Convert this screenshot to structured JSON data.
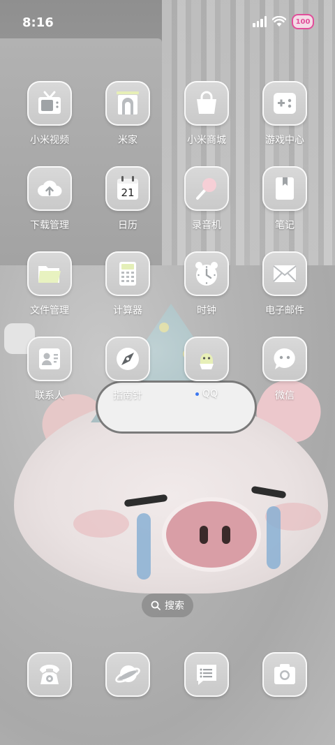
{
  "status_bar": {
    "time": "8:16",
    "battery_level": "100",
    "icons": [
      "signal-icon",
      "wifi-icon",
      "battery-icon"
    ],
    "battery_accent": "#e14e9a"
  },
  "apps": [
    {
      "label": "小米视频",
      "icon": "tv-icon"
    },
    {
      "label": "米家",
      "icon": "home-gate-icon"
    },
    {
      "label": "小米商城",
      "icon": "shopping-bag-icon"
    },
    {
      "label": "游戏中心",
      "icon": "gamepad-icon"
    },
    {
      "label": "下载管理",
      "icon": "cloud-download-icon"
    },
    {
      "label": "日历",
      "icon": "calendar-icon",
      "day": "21"
    },
    {
      "label": "录音机",
      "icon": "microphone-icon"
    },
    {
      "label": "笔记",
      "icon": "notebook-icon"
    },
    {
      "label": "文件管理",
      "icon": "folder-icon"
    },
    {
      "label": "计算器",
      "icon": "calculator-icon"
    },
    {
      "label": "时钟",
      "icon": "alarm-clock-icon"
    },
    {
      "label": "电子邮件",
      "icon": "envelope-icon"
    },
    {
      "label": "联系人",
      "icon": "contact-card-icon"
    },
    {
      "label": "指南针",
      "icon": "compass-icon"
    },
    {
      "label": "QQ",
      "icon": "penguin-icon",
      "new_indicator": true
    },
    {
      "label": "微信",
      "icon": "chat-bubble-icon"
    }
  ],
  "search": {
    "label": "搜索",
    "icon": "search-icon"
  },
  "dock": [
    {
      "name": "phone",
      "icon": "phone-icon"
    },
    {
      "name": "browser",
      "icon": "planet-icon"
    },
    {
      "name": "messages",
      "icon": "message-icon"
    },
    {
      "name": "camera",
      "icon": "camera-icon"
    }
  ]
}
